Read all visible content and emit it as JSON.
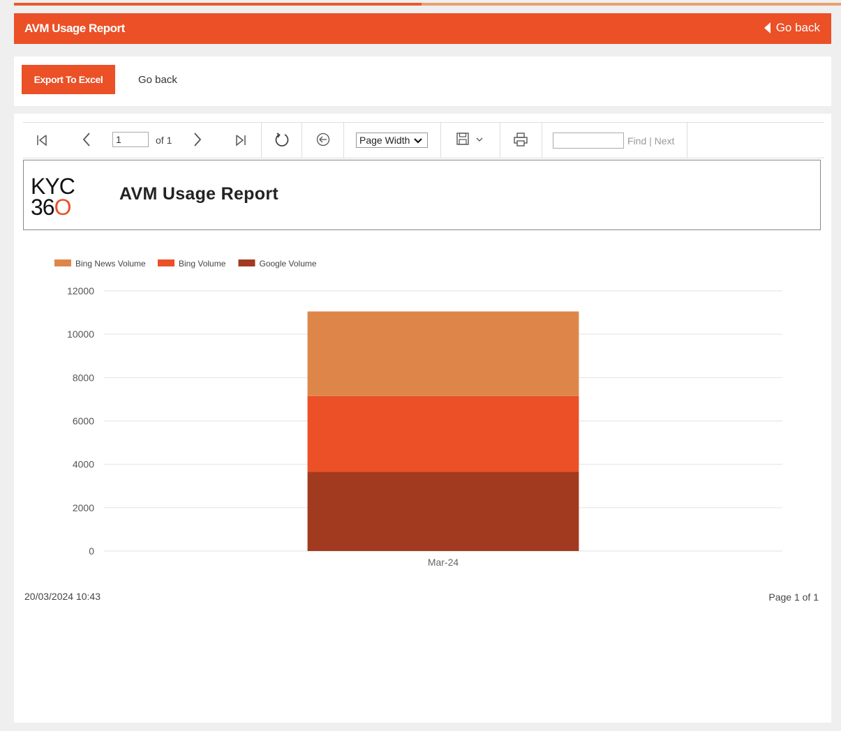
{
  "header": {
    "title": "AVM Usage Report",
    "goback_label": "Go back"
  },
  "actions": {
    "export_label": "Export To Excel",
    "goback_label": "Go back"
  },
  "toolbar": {
    "page_value": "1",
    "of_pages": "of 1",
    "zoom_value": "Page Width",
    "find_link": "Find | Next",
    "icons": [
      "first-page-icon",
      "prev-page-icon",
      "next-page-icon",
      "last-page-icon",
      "refresh-icon",
      "back-icon",
      "save-icon",
      "print-icon"
    ]
  },
  "report": {
    "logo_line1": "KYC",
    "logo_line2_prefix": "36",
    "logo_line2_o": "O",
    "title": "AVM Usage Report",
    "generated": "20/03/2024 10:43",
    "page_info": "Page 1 of 1"
  },
  "chart_data": {
    "type": "bar",
    "stacked": true,
    "categories": [
      "Mar-24"
    ],
    "series": [
      {
        "name": "Google Volume",
        "values": [
          3650
        ],
        "color": "#a23a1f"
      },
      {
        "name": "Bing Volume",
        "values": [
          3500
        ],
        "color": "#eb5026"
      },
      {
        "name": "Bing News Volume",
        "values": [
          3900
        ],
        "color": "#de8649"
      }
    ],
    "legend_order": [
      "Bing News Volume",
      "Bing Volume",
      "Google Volume"
    ],
    "legend_position": "top-left",
    "ylim": [
      0,
      12000
    ],
    "yticks": [
      0,
      2000,
      4000,
      6000,
      8000,
      10000,
      12000
    ],
    "grid": true,
    "title": "",
    "xlabel": "",
    "ylabel": ""
  }
}
